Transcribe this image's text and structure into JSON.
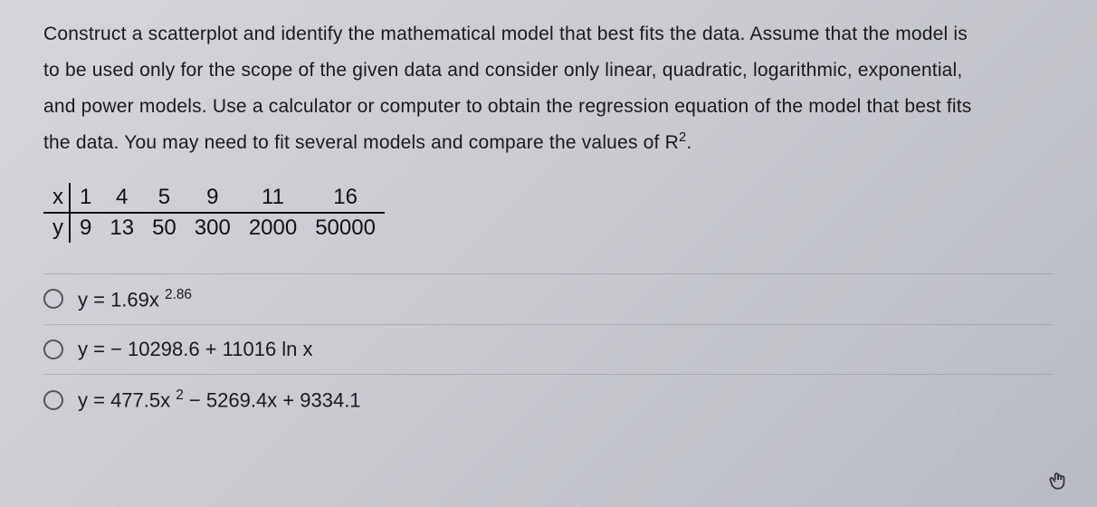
{
  "question": {
    "line1": "Construct a scatterplot and identify the mathematical model that best fits the data. Assume that the model is",
    "line2": "to be used only for the scope of the given data and consider only linear, quadratic, logarithmic, exponential,",
    "line3": "and power models. Use a calculator or computer to obtain the regression equation of the model that best fits",
    "line4_a": "the data. You may need to fit several models and compare the values of R",
    "line4_sup": "2",
    "line4_b": "."
  },
  "table": {
    "xlabel": "x",
    "ylabel": "y",
    "x": [
      "1",
      "4",
      "5",
      "9",
      "11",
      "16"
    ],
    "y": [
      "9",
      "13",
      "50",
      "300",
      "2000",
      "50000"
    ]
  },
  "answers": {
    "a": {
      "pre": "y = 1.69x ",
      "sup": "2.86",
      "post": ""
    },
    "b": {
      "pre": "y = ",
      "sup": "",
      "post": " − 10298.6 + 11016 ln x"
    },
    "c": {
      "pre": "y = 477.5x ",
      "sup": "2",
      "post": " − 5269.4x + 9334.1"
    }
  },
  "chart_data": {
    "type": "table",
    "series": [
      {
        "name": "x",
        "values": [
          1,
          4,
          5,
          9,
          11,
          16
        ]
      },
      {
        "name": "y",
        "values": [
          9,
          13,
          50,
          300,
          2000,
          50000
        ]
      }
    ]
  }
}
